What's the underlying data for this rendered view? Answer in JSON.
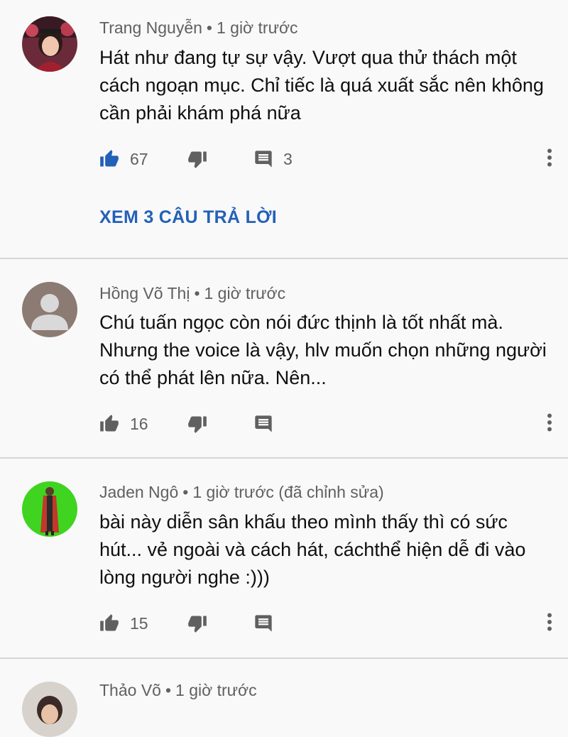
{
  "comments": [
    {
      "author": "Trang Nguyễn",
      "time": "1 giờ trước",
      "text": "Hát như đang tự sự vậy. Vượt qua thử thách một cách ngoạn mục. Chỉ tiếc là quá xuất sắc nên không cần phải khám phá nữa",
      "likes": "67",
      "liked": true,
      "reply_count": "3",
      "view_replies": "XEM 3 CÂU TRẢ LỜI"
    },
    {
      "author": "Hồng Võ Thị",
      "time": "1 giờ trước",
      "text": "Chú tuấn ngọc còn nói đức thịnh là tốt nhất mà. Nhưng the voice là vậy, hlv muốn chọn những người có thể phát lên nữa. Nên...",
      "likes": "16",
      "liked": false
    },
    {
      "author": "Jaden Ngô",
      "time": "1 giờ trước (đã chỉnh sửa)",
      "text": "bài này diễn sân khấu theo mình thấy thì có sức hút... vẻ ngoài và cách hát, cáchthể hiện dễ đi vào lòng người nghe :)))",
      "likes": "15",
      "liked": false
    },
    {
      "author": "Thảo Võ",
      "time": "1 giờ trước"
    }
  ],
  "colors": {
    "liked": "#2361b8",
    "icon": "#606060",
    "link": "#2361b8",
    "divider": "#d6d6d6",
    "background": "#f9f9f9"
  }
}
